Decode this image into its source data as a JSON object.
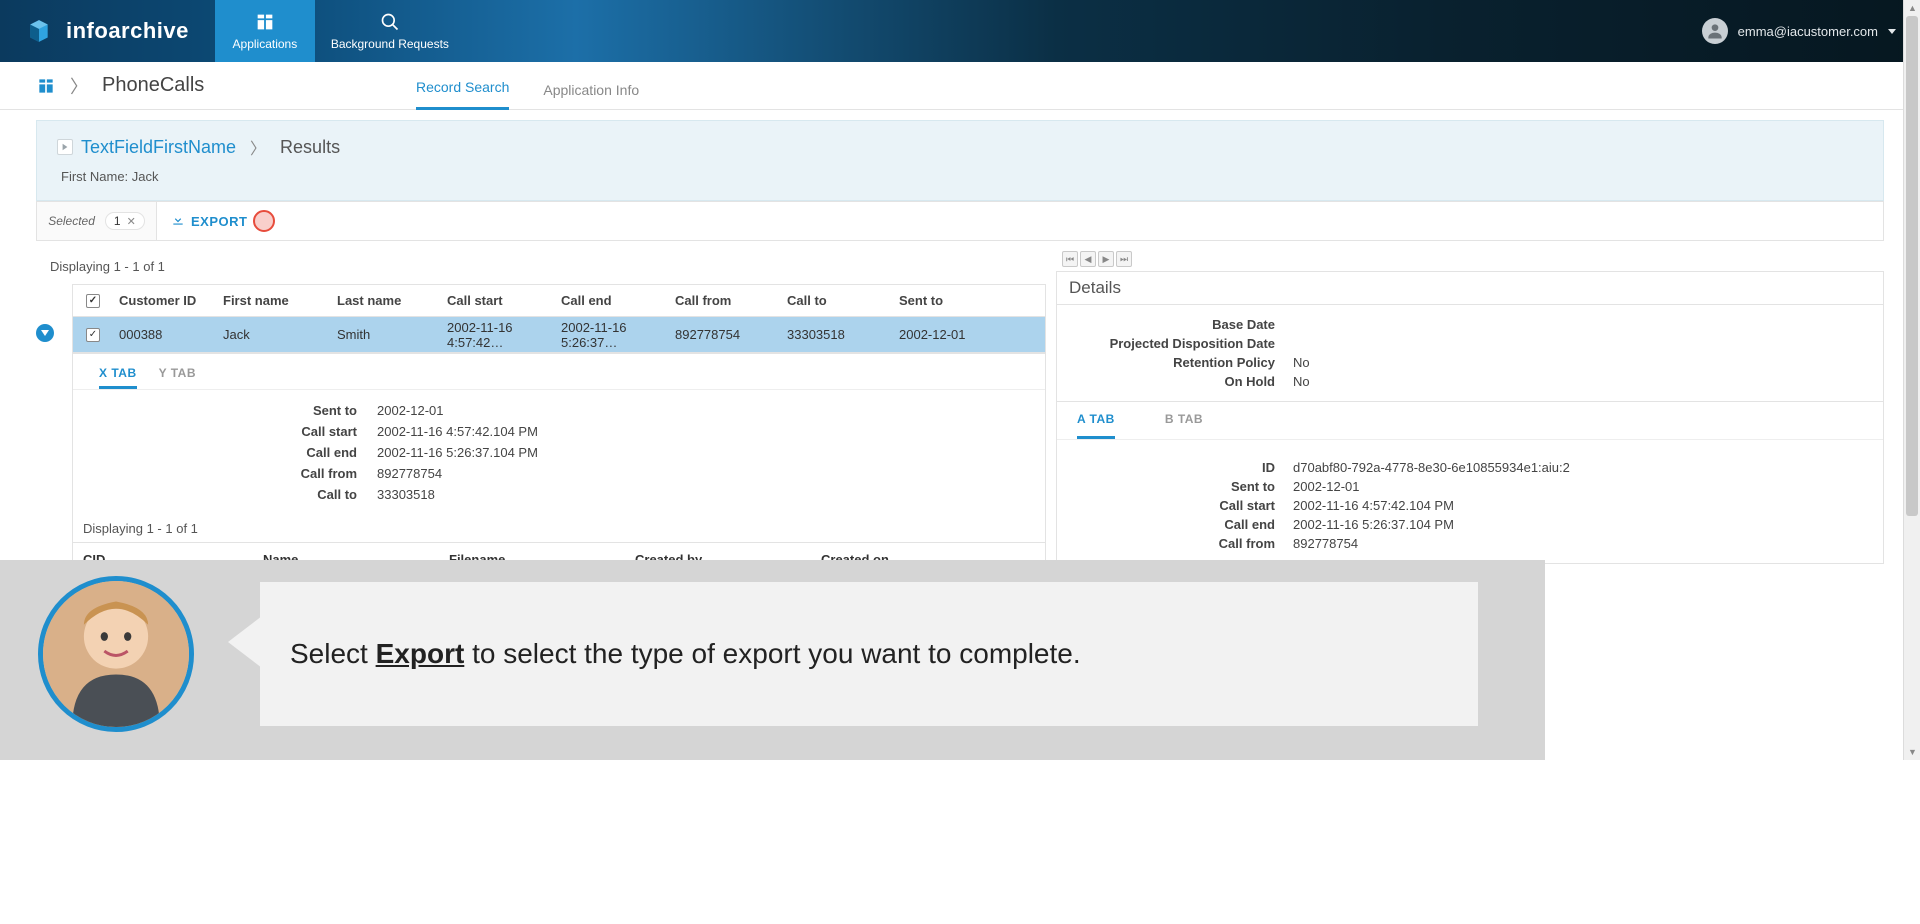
{
  "header": {
    "brand": "infoarchive",
    "nav": {
      "applications": "Applications",
      "background_requests": "Background Requests"
    },
    "user": "emma@iacustomer.com"
  },
  "breadcrumb": {
    "app_name": "PhoneCalls",
    "tabs": {
      "record_search": "Record Search",
      "app_info": "Application Info"
    }
  },
  "context": {
    "search_name": "TextFieldFirstName",
    "results_label": "Results",
    "filter_label": "First Name: Jack"
  },
  "toolbar": {
    "selected_label": "Selected",
    "selected_count": "1",
    "export_label": "EXPORT"
  },
  "results": {
    "displaying": "Displaying 1 - 1 of 1",
    "columns": {
      "customer_id": "Customer ID",
      "first_name": "First name",
      "last_name": "Last name",
      "call_start": "Call start",
      "call_end": "Call end",
      "call_from": "Call from",
      "call_to": "Call to",
      "sent_to": "Sent to"
    },
    "row": {
      "customer_id": "000388",
      "first_name": "Jack",
      "last_name": "Smith",
      "call_start": "2002-11-16 4:57:42…",
      "call_end": "2002-11-16 5:26:37…",
      "call_from": "892778754",
      "call_to": "33303518",
      "sent_to": "2002-12-01"
    },
    "row_tabs": {
      "x": "X TAB",
      "y": "Y TAB"
    },
    "row_details": {
      "sent_to_label": "Sent to",
      "sent_to": "2002-12-01",
      "call_start_label": "Call start",
      "call_start": "2002-11-16 4:57:42.104 PM",
      "call_end_label": "Call end",
      "call_end": "2002-11-16 5:26:37.104 PM",
      "call_from_label": "Call from",
      "call_from": "892778754",
      "call_to_label": "Call to",
      "call_to": "33303518"
    },
    "sub_displaying": "Displaying 1 - 1 of 1",
    "sub_columns": {
      "cid": "CID",
      "name": "Name",
      "filename": "Filename",
      "created_by": "Created by",
      "created_on": "Created on"
    }
  },
  "details": {
    "title": "Details",
    "meta": {
      "base_date_label": "Base Date",
      "base_date": "",
      "pdd_label": "Projected Disposition Date",
      "pdd": "",
      "retention_label": "Retention Policy",
      "retention": "No",
      "hold_label": "On Hold",
      "hold": "No"
    },
    "tabs": {
      "a": "A TAB",
      "b": "B TAB"
    },
    "body": {
      "id_label": "ID",
      "id": "d70abf80-792a-4778-8e30-6e10855934e1:aiu:2",
      "sent_to_label": "Sent to",
      "sent_to": "2002-12-01",
      "call_start_label": "Call start",
      "call_start": "2002-11-16 4:57:42.104 PM",
      "call_end_label": "Call end",
      "call_end": "2002-11-16 5:26:37.104 PM",
      "call_from_label": "Call from",
      "call_from": "892778754"
    }
  },
  "coach": {
    "text_pre": "Select ",
    "text_bold": "Export",
    "text_post": " to select the type of export you want to complete."
  }
}
